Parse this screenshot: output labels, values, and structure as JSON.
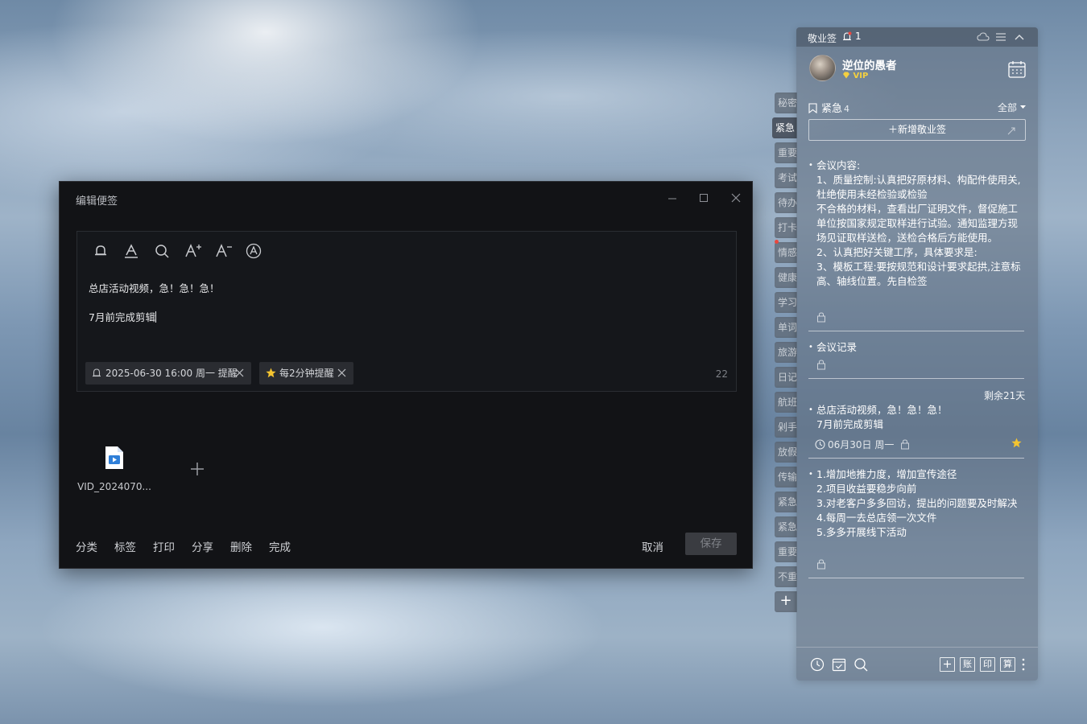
{
  "editor": {
    "title": "编辑便签",
    "note_line1": "总店活动视频，急！急！急！",
    "note_line2": "7月前完成剪辑",
    "reminder_chip": "2025-06-30 16:00 周一 提醒",
    "repeat_chip": "每2分钟提醒",
    "char_count": "22",
    "attachment_name": "VID_2024070...",
    "footer": {
      "category": "分类",
      "tag": "标签",
      "print": "打印",
      "share": "分享",
      "delete": "删除",
      "done": "完成",
      "cancel": "取消",
      "save": "保存"
    }
  },
  "side_tabs": [
    "秘密",
    "紧急",
    "重要",
    "考试",
    "待办",
    "打卡",
    "情感",
    "健康",
    "学习",
    "单词",
    "旅游",
    "日记",
    "航班",
    "剁手",
    "放假",
    "传输",
    "紧急",
    "紧急",
    "重要",
    "不重"
  ],
  "side_tab_add": "+",
  "panel": {
    "app_name": "敬业签",
    "notification_count": "1",
    "username": "逆位的愚者",
    "vip_label": "VIP",
    "category_name": "紧急",
    "category_count": "4",
    "filter": "全部",
    "add_button": "＋新增敬业签",
    "notes": [
      {
        "text": "会议内容:\n1、质量控制:认真把好原材料、构配件使用关,杜绝使用未经检验或检验\n不合格的材料，查看出厂证明文件，督促施工单位按国家规定取样进行试验。通知监理方现场见证取样送检，送检合格后方能使用。\n2、认真把好关键工序，具体要求是:\n3、模板工程:要按规范和设计要求起拱,注意标高、轴线位置。先自检签"
      },
      {
        "text": "会议记录"
      },
      {
        "remaining": "剩余21天",
        "text": "总店活动视频，急！急！急！\n7月前完成剪辑",
        "due": "06月30日 周一"
      },
      {
        "text": "1.增加地推力度，增加宣传途径\n2.项目收益要稳步向前\n3.对老客户多多回访，提出的问题要及时解决\n4.每周一去总店领一次文件\n5.多多开展线下活动"
      }
    ],
    "bottom_buttons": [
      "账",
      "印",
      "算"
    ]
  },
  "colors": {
    "editor_bg": "#121316",
    "panel_bg": "rgba(98,112,128,0.55)",
    "star": "#f4d03f",
    "save_disabled": "#3a3c41"
  }
}
